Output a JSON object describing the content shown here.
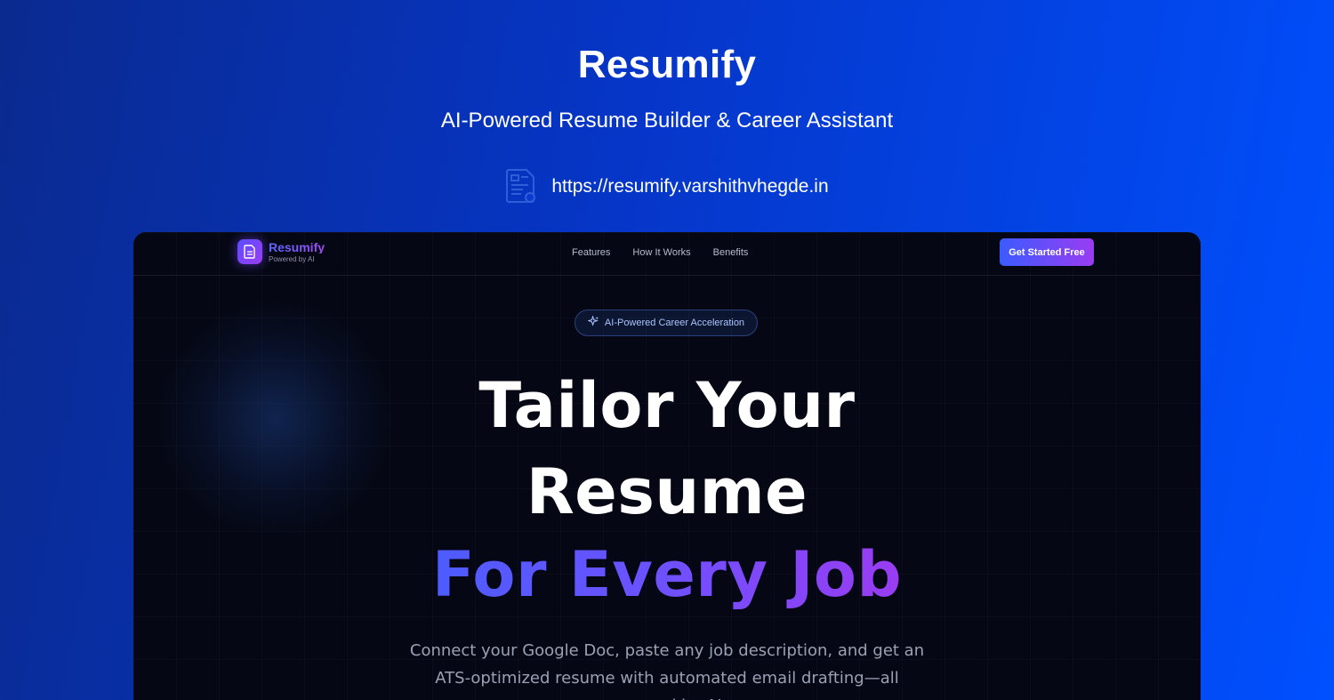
{
  "header": {
    "title": "Resumify",
    "subtitle": "AI-Powered Resume Builder & Career Assistant",
    "url": "https://resumify.varshithvhegde.in"
  },
  "app": {
    "nav": {
      "brand_name": "Resumify",
      "brand_tagline": "Powered by AI",
      "links": [
        "Features",
        "How It Works",
        "Benefits"
      ],
      "cta_label": "Get Started Free"
    },
    "hero": {
      "badge": "AI-Powered Career Acceleration",
      "headline_line1": "Tailor Your",
      "headline_line2": "Resume",
      "headline_highlight": "For Every Job",
      "description": "Connect your Google Doc, paste any job description, and get an ATS-optimized resume with automated email drafting—all powered by AI."
    }
  },
  "colors": {
    "background_gradient_start": "#0a2a8f",
    "background_gradient_end": "#0050ff",
    "app_background": "#050814",
    "accent_blue": "#3b5bff",
    "accent_purple": "#9a3cf2",
    "badge_text": "#a9c4ff"
  },
  "icons": {
    "url_icon": "document-link-icon",
    "brand_icon": "document-icon",
    "badge_icon": "sparkles-icon"
  }
}
